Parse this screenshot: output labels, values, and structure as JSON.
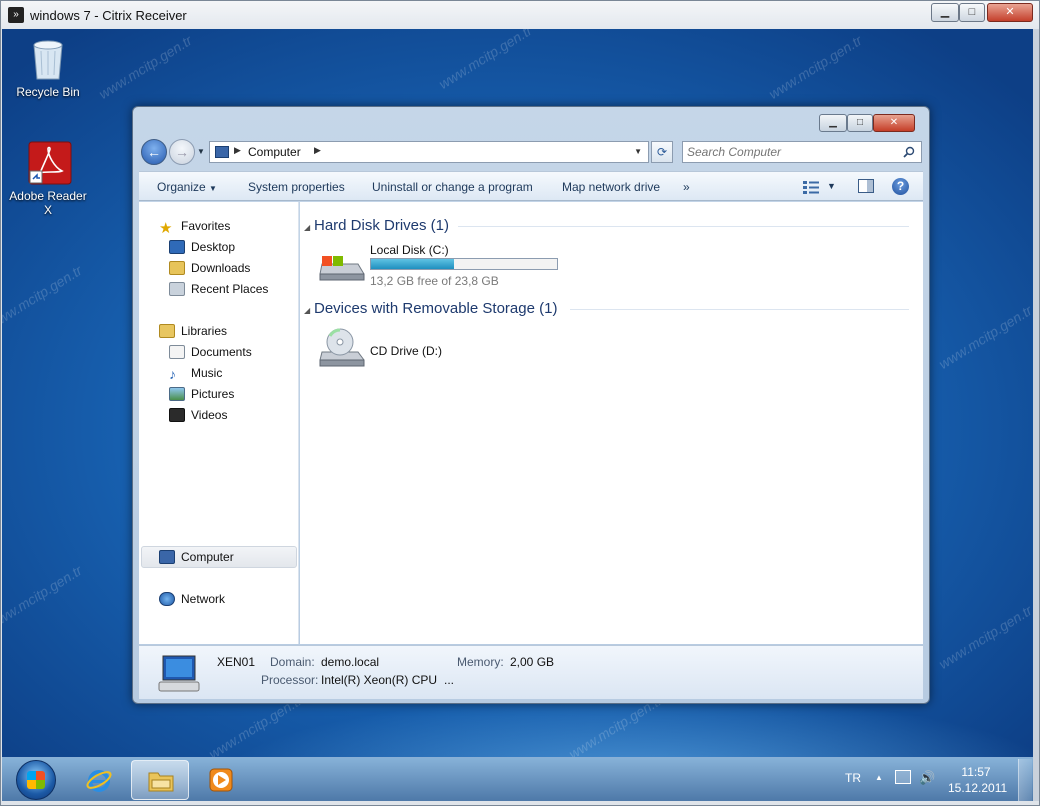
{
  "outer_window": {
    "title": "windows 7 - Citrix Receiver",
    "minimize": "▁",
    "maximize": "□",
    "close": "✕"
  },
  "desktop": {
    "icons": [
      {
        "label": "Recycle Bin",
        "icon": "recycle-bin-icon"
      },
      {
        "label": "Adobe Reader X",
        "icon": "adobe-reader-icon"
      }
    ],
    "watermark": "www.mcitp.gen.tr"
  },
  "explorer": {
    "address": {
      "location": "Computer",
      "sep": "▶",
      "dropdown": "▼"
    },
    "refresh_glyph": "⟳",
    "search": {
      "placeholder": "Search Computer"
    },
    "commands": {
      "organize": "Organize",
      "system_properties": "System properties",
      "uninstall": "Uninstall or change a program",
      "map_drive": "Map network drive",
      "more": "»",
      "help": "?"
    },
    "nav": {
      "favorites": "Favorites",
      "desktop": "Desktop",
      "downloads": "Downloads",
      "recent_places": "Recent Places",
      "libraries": "Libraries",
      "documents": "Documents",
      "music": "Music",
      "pictures": "Pictures",
      "videos": "Videos",
      "computer": "Computer",
      "network": "Network"
    },
    "groups": {
      "hard_disk": "Hard Disk Drives (1)",
      "removable": "Devices with Removable Storage (1)"
    },
    "drives": {
      "local_disk_name": "Local Disk (C:)",
      "local_disk_free": "13,2 GB free of 23,8 GB",
      "local_disk_used_fraction": 0.445,
      "cd_name": "CD Drive (D:)"
    },
    "details": {
      "computer_name": "XEN01",
      "domain_label": "Domain:",
      "domain_value": "demo.local",
      "memory_label": "Memory:",
      "memory_value": "2,00 GB",
      "processor_label": "Processor:",
      "processor_value": "Intel(R) Xeon(R) CPU",
      "processor_more": "..."
    }
  },
  "taskbar": {
    "language": "TR",
    "tray_up": "▲",
    "volume": "🔊",
    "time": "11:57",
    "date": "15.12.2011"
  }
}
